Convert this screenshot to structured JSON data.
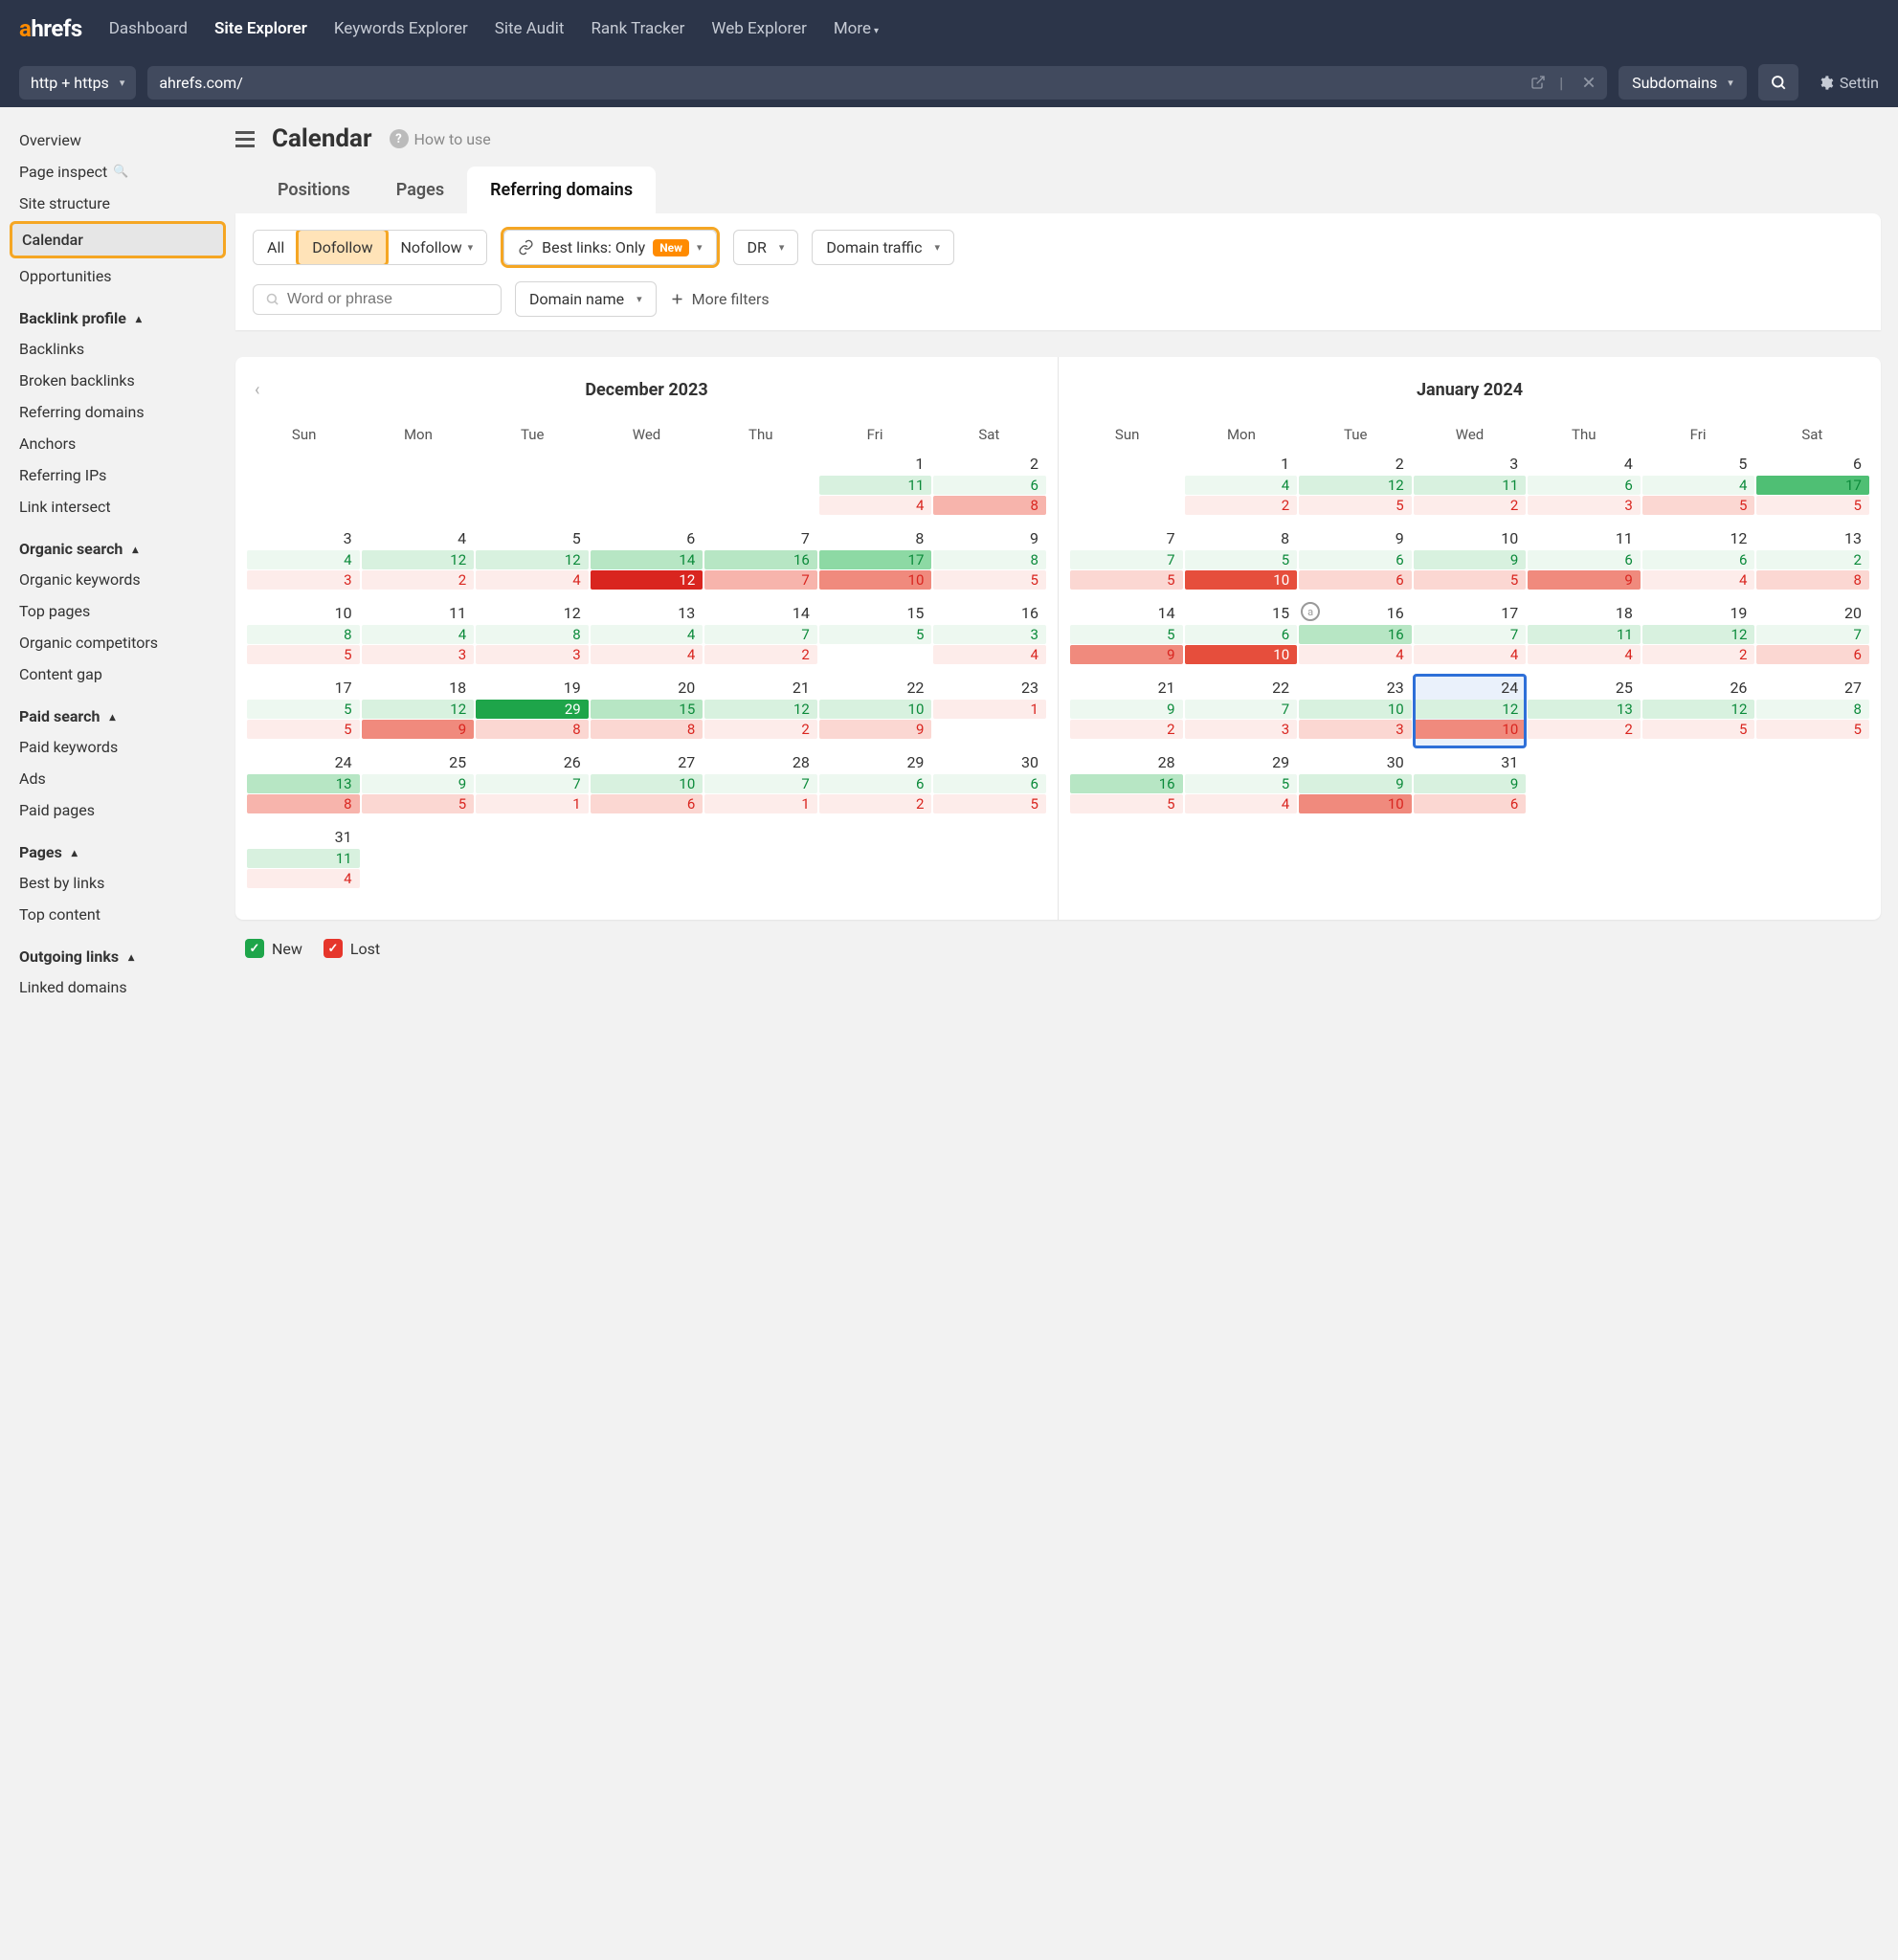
{
  "logo": {
    "part1": "a",
    "part2": "hrefs"
  },
  "nav": {
    "links": [
      "Dashboard",
      "Site Explorer",
      "Keywords Explorer",
      "Site Audit",
      "Rank Tracker",
      "Web Explorer",
      "More"
    ],
    "active": 1
  },
  "urlrow": {
    "protocol": "http + https",
    "url": "ahrefs.com/",
    "scope": "Subdomains",
    "settings": "Settin"
  },
  "sidebar": {
    "top": [
      "Overview",
      "Page inspect",
      "Site structure",
      "Calendar",
      "Opportunities"
    ],
    "groups": [
      {
        "title": "Backlink profile",
        "items": [
          "Backlinks",
          "Broken backlinks",
          "Referring domains",
          "Anchors",
          "Referring IPs",
          "Link intersect"
        ]
      },
      {
        "title": "Organic search",
        "items": [
          "Organic keywords",
          "Top pages",
          "Organic competitors",
          "Content gap"
        ]
      },
      {
        "title": "Paid search",
        "items": [
          "Paid keywords",
          "Ads",
          "Paid pages"
        ]
      },
      {
        "title": "Pages",
        "items": [
          "Best by links",
          "Top content"
        ]
      },
      {
        "title": "Outgoing links",
        "items": [
          "Linked domains"
        ]
      }
    ],
    "selected": "Calendar"
  },
  "header": {
    "title": "Calendar",
    "howto": "How to use"
  },
  "tabs": {
    "items": [
      "Positions",
      "Pages",
      "Referring domains"
    ],
    "active": 2
  },
  "filters": {
    "seg": [
      "All",
      "Dofollow",
      "Nofollow"
    ],
    "seg_selected": 1,
    "bestlinks_label": "Best links: Only",
    "new_badge": "New",
    "dr": "DR",
    "traffic": "Domain traffic",
    "search_ph": "Word or phrase",
    "domain_name": "Domain name",
    "more": "More filters"
  },
  "dow": [
    "Sun",
    "Mon",
    "Tue",
    "Wed",
    "Thu",
    "Fri",
    "Sat"
  ],
  "months": [
    {
      "title": "December 2023",
      "prev": true,
      "weeks": [
        [
          null,
          null,
          null,
          null,
          null,
          {
            "d": 1,
            "g": 11,
            "gi": 2,
            "l": 4,
            "li": 1
          },
          {
            "d": 2,
            "g": 6,
            "gi": 1,
            "l": 8,
            "li": 3
          }
        ],
        [
          {
            "d": 3,
            "g": 4,
            "gi": 1,
            "l": 3,
            "li": 1
          },
          {
            "d": 4,
            "g": 12,
            "gi": 2,
            "l": 2,
            "li": 1
          },
          {
            "d": 5,
            "g": 12,
            "gi": 2,
            "l": 4,
            "li": 1
          },
          {
            "d": 6,
            "g": 14,
            "gi": 3,
            "l": 12,
            "li": 6
          },
          {
            "d": 7,
            "g": 16,
            "gi": 3,
            "l": 7,
            "li": 3
          },
          {
            "d": 8,
            "g": 17,
            "gi": 4,
            "l": 10,
            "li": 4
          },
          {
            "d": 9,
            "g": 8,
            "gi": 1,
            "l": 5,
            "li": 1
          }
        ],
        [
          {
            "d": 10,
            "g": 8,
            "gi": 1,
            "l": 5,
            "li": 1
          },
          {
            "d": 11,
            "g": 4,
            "gi": 1,
            "l": 3,
            "li": 1
          },
          {
            "d": 12,
            "g": 8,
            "gi": 1,
            "l": 3,
            "li": 1
          },
          {
            "d": 13,
            "g": 4,
            "gi": 1,
            "l": 4,
            "li": 1
          },
          {
            "d": 14,
            "g": 7,
            "gi": 1,
            "l": 2,
            "li": 1
          },
          {
            "d": 15,
            "g": 5,
            "gi": 1,
            "l": null,
            "li": 0
          },
          {
            "d": 16,
            "g": 3,
            "gi": 1,
            "l": 4,
            "li": 1
          }
        ],
        [
          {
            "d": 17,
            "g": 5,
            "gi": 1,
            "l": 5,
            "li": 1
          },
          {
            "d": 18,
            "g": 12,
            "gi": 2,
            "l": 9,
            "li": 4
          },
          {
            "d": 19,
            "g": 29,
            "gi": 6,
            "l": 8,
            "li": 2
          },
          {
            "d": 20,
            "g": 15,
            "gi": 3,
            "l": 8,
            "li": 2
          },
          {
            "d": 21,
            "g": 12,
            "gi": 2,
            "l": 2,
            "li": 1
          },
          {
            "d": 22,
            "g": 10,
            "gi": 2,
            "l": 9,
            "li": 2
          },
          {
            "d": 23,
            "g": null,
            "gi": 0,
            "l": 1,
            "li": 1
          }
        ],
        [
          {
            "d": 24,
            "g": 13,
            "gi": 3,
            "l": 8,
            "li": 3
          },
          {
            "d": 25,
            "g": 9,
            "gi": 1,
            "l": 5,
            "li": 2
          },
          {
            "d": 26,
            "g": 7,
            "gi": 1,
            "l": 1,
            "li": 1
          },
          {
            "d": 27,
            "g": 10,
            "gi": 2,
            "l": 6,
            "li": 2
          },
          {
            "d": 28,
            "g": 7,
            "gi": 1,
            "l": 1,
            "li": 1
          },
          {
            "d": 29,
            "g": 6,
            "gi": 1,
            "l": 2,
            "li": 1
          },
          {
            "d": 30,
            "g": 6,
            "gi": 1,
            "l": 5,
            "li": 1
          }
        ],
        [
          {
            "d": 31,
            "g": 11,
            "gi": 2,
            "l": 4,
            "li": 1
          },
          null,
          null,
          null,
          null,
          null,
          null
        ]
      ]
    },
    {
      "title": "January 2024",
      "prev": false,
      "weeks": [
        [
          null,
          {
            "d": 1,
            "g": 4,
            "gi": 1,
            "l": 2,
            "li": 1
          },
          {
            "d": 2,
            "g": 12,
            "gi": 2,
            "l": 5,
            "li": 1
          },
          {
            "d": 3,
            "g": 11,
            "gi": 2,
            "l": 2,
            "li": 1
          },
          {
            "d": 4,
            "g": 6,
            "gi": 1,
            "l": 3,
            "li": 1
          },
          {
            "d": 5,
            "g": 4,
            "gi": 1,
            "l": 5,
            "li": 2
          },
          {
            "d": 6,
            "g": 17,
            "gi": 5,
            "l": 5,
            "li": 1
          }
        ],
        [
          {
            "d": 7,
            "g": 7,
            "gi": 1,
            "l": 5,
            "li": 2
          },
          {
            "d": 8,
            "g": 5,
            "gi": 1,
            "l": 10,
            "li": 5
          },
          {
            "d": 9,
            "g": 6,
            "gi": 1,
            "l": 6,
            "li": 2
          },
          {
            "d": 10,
            "g": 9,
            "gi": 2,
            "l": 5,
            "li": 2
          },
          {
            "d": 11,
            "g": 6,
            "gi": 1,
            "l": 9,
            "li": 4
          },
          {
            "d": 12,
            "g": 6,
            "gi": 1,
            "l": 4,
            "li": 1
          },
          {
            "d": 13,
            "g": 2,
            "gi": 1,
            "l": 8,
            "li": 2
          }
        ],
        [
          {
            "d": 14,
            "g": 5,
            "gi": 1,
            "l": 9,
            "li": 4
          },
          {
            "d": 15,
            "g": 6,
            "gi": 1,
            "l": 10,
            "li": 5
          },
          {
            "d": 16,
            "g": 16,
            "gi": 3,
            "l": 4,
            "li": 1,
            "annot": "a"
          },
          {
            "d": 17,
            "g": 7,
            "gi": 1,
            "l": 4,
            "li": 1
          },
          {
            "d": 18,
            "g": 11,
            "gi": 2,
            "l": 4,
            "li": 1
          },
          {
            "d": 19,
            "g": 12,
            "gi": 2,
            "l": 2,
            "li": 1
          },
          {
            "d": 20,
            "g": 7,
            "gi": 1,
            "l": 6,
            "li": 2
          }
        ],
        [
          {
            "d": 21,
            "g": 9,
            "gi": 1,
            "l": 2,
            "li": 1
          },
          {
            "d": 22,
            "g": 7,
            "gi": 1,
            "l": 3,
            "li": 1
          },
          {
            "d": 23,
            "g": 10,
            "gi": 2,
            "l": 3,
            "li": 2
          },
          {
            "d": 24,
            "g": 12,
            "gi": 2,
            "l": 10,
            "li": 4,
            "selected": true
          },
          {
            "d": 25,
            "g": 13,
            "gi": 2,
            "l": 2,
            "li": 1
          },
          {
            "d": 26,
            "g": 12,
            "gi": 2,
            "l": 5,
            "li": 1
          },
          {
            "d": 27,
            "g": 8,
            "gi": 1,
            "l": 5,
            "li": 1
          }
        ],
        [
          {
            "d": 28,
            "g": 16,
            "gi": 3,
            "l": 5,
            "li": 1
          },
          {
            "d": 29,
            "g": 5,
            "gi": 1,
            "l": 4,
            "li": 1
          },
          {
            "d": 30,
            "g": 9,
            "gi": 2,
            "l": 10,
            "li": 4
          },
          {
            "d": 31,
            "g": 9,
            "gi": 2,
            "l": 6,
            "li": 2
          },
          null,
          null,
          null
        ]
      ]
    }
  ],
  "legend": {
    "new": "New",
    "lost": "Lost"
  }
}
